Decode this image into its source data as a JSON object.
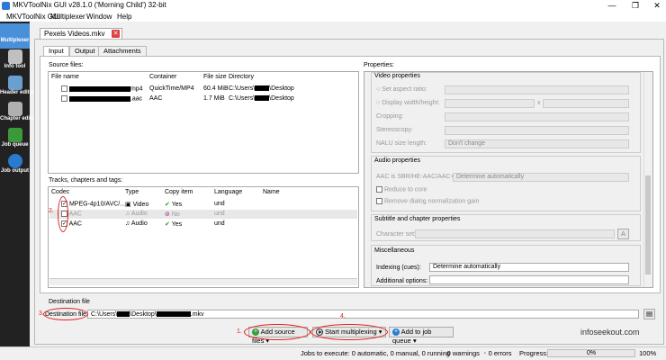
{
  "window": {
    "title": "MKVToolNix GUI v28.1.0 ('Morning Child') 32-bit",
    "min": "—",
    "max": "❐",
    "close": "✕"
  },
  "menu": [
    "MKVToolNix GUI",
    "Multiplexer",
    "Window",
    "Help"
  ],
  "sidebar": [
    {
      "label": "Multiplexer",
      "icon": "multiplexer-icon",
      "color": "#4a90d9"
    },
    {
      "label": "Info tool",
      "icon": "info-tool-icon",
      "color": "#c0c0c0"
    },
    {
      "label": "Header editor",
      "icon": "header-editor-icon",
      "color": "#6aa0d0"
    },
    {
      "label": "Chapter editor",
      "icon": "chapter-editor-icon",
      "color": "#b0b0b0"
    },
    {
      "label": "Job queue",
      "icon": "job-queue-icon",
      "color": "#3a9a3a"
    },
    {
      "label": "Job output",
      "icon": "job-output-icon",
      "color": "#2a7bd0"
    }
  ],
  "file_tab": {
    "label": "Pexels Videos.mkv",
    "close": "✕"
  },
  "subtabs": [
    "Input",
    "Output",
    "Attachments"
  ],
  "source_files": {
    "label": "Source files:",
    "headers": [
      "File name",
      "Container",
      "File size",
      "Directory"
    ],
    "rows": [
      {
        "name_suffix": "mp4",
        "container": "QuickTime/MP4",
        "size": "60.4 MiB",
        "dir_prefix": "C:\\Users\\",
        "dir_suffix": "\\Desktop"
      },
      {
        "name_suffix": ".aac",
        "container": "AAC",
        "size": "1.7 MiB",
        "dir_prefix": "C:\\Users\\",
        "dir_suffix": "\\Desktop"
      }
    ]
  },
  "tracks": {
    "label": "Tracks, chapters and tags:",
    "headers": [
      "Codec",
      "Type",
      "Copy item",
      "Language",
      "Name"
    ],
    "rows": [
      {
        "codec": "MPEG-4p10/AVC/...",
        "type": "Video",
        "copy": "Yes",
        "lang": "und",
        "checked": true
      },
      {
        "codec": "AAC",
        "type": "Audio",
        "copy": "No",
        "lang": "und",
        "checked": false
      },
      {
        "codec": "AAC",
        "type": "Audio",
        "copy": "Yes",
        "lang": "und",
        "checked": true
      }
    ]
  },
  "properties": {
    "label": "Properties:",
    "video": {
      "title": "Video properties",
      "aspect": "Set aspect ratio:",
      "display": "Display width/height:",
      "x": "x",
      "cropping": "Cropping:",
      "stereo": "Stereoscopy:",
      "nalu": "NALU size length:",
      "nalu_value": "Don't change"
    },
    "audio": {
      "title": "Audio properties",
      "sbr": "AAC is SBR/HE-AAC/AAC+:",
      "sbr_value": "Determine automatically",
      "reduce": "Reduce to core",
      "remove_gain": "Remove dialog normalization gain"
    },
    "subtitle": {
      "title": "Subtitle and chapter properties",
      "charset": "Character set:"
    },
    "misc": {
      "title": "Miscellaneous",
      "indexing": "Indexing (cues):",
      "indexing_value": "Determine automatically",
      "options": "Additional options:"
    }
  },
  "destination": {
    "label": "Destination file",
    "field_label": "Destination file:",
    "path_prefix": "C:\\Users\\",
    "path_mid": "\\Desktop\\",
    "path_suffix": ".mkv"
  },
  "actions": {
    "add": "Add source files",
    "start": "Start multiplexing",
    "queue": "Add to job queue"
  },
  "annotations": {
    "n1": "1.",
    "n2": "2.",
    "n3": "3.",
    "n4": "4."
  },
  "watermark": "infoseekout.com",
  "status": {
    "jobs": "Jobs to execute:  0 automatic, 0 manual, 0 running",
    "warnings": "0 warnings",
    "errors": "0 errors",
    "progress_label": "Progress:",
    "progress_value": "0%",
    "progress_max": "100%"
  }
}
